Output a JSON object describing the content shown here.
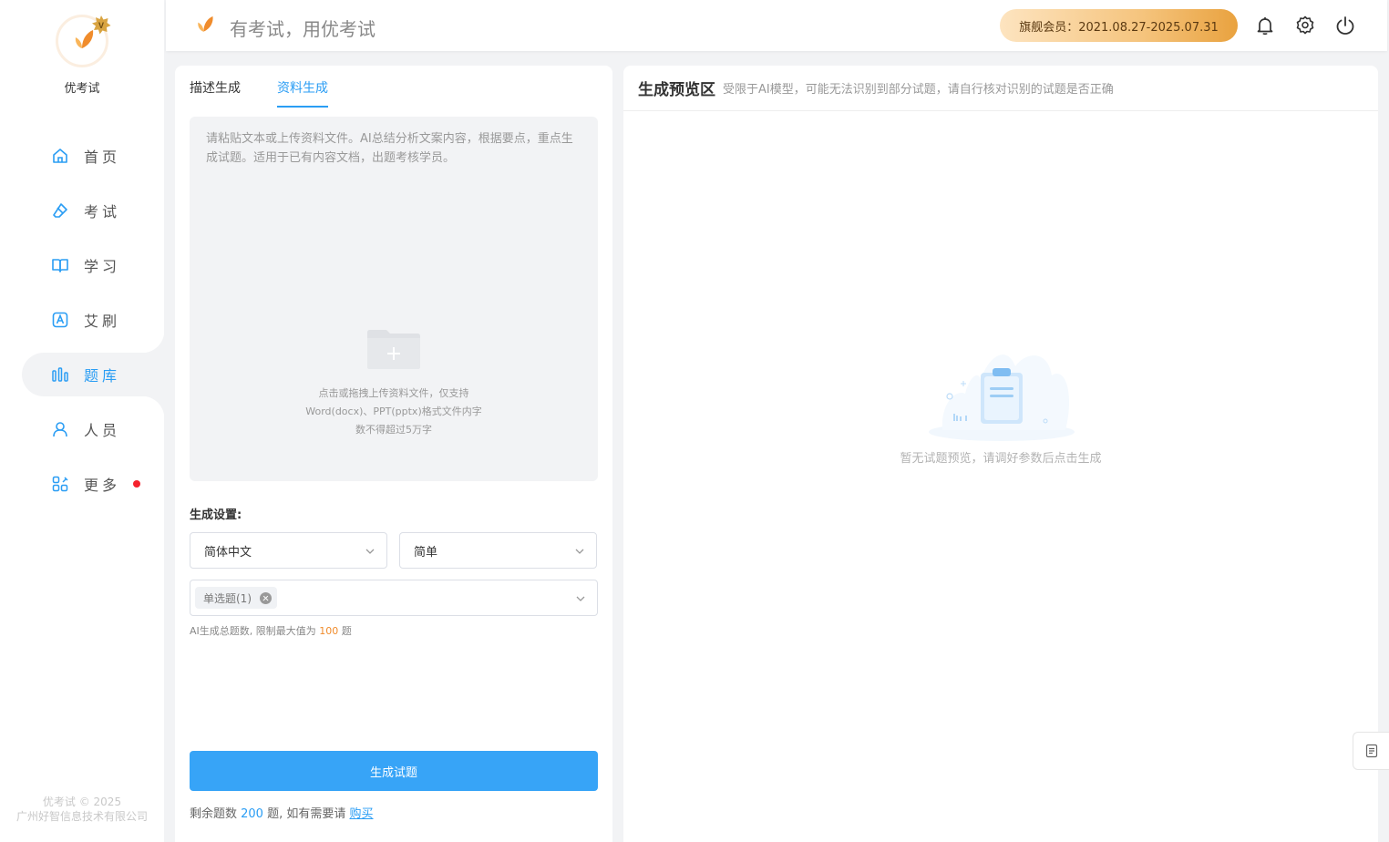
{
  "brand": {
    "name": "优考试",
    "footer_line1": "优考试 © 2025",
    "footer_line2": "广州好智信息技术有限公司"
  },
  "nav": {
    "items": [
      {
        "label": "首页",
        "icon": "home-icon"
      },
      {
        "label": "考试",
        "icon": "eraser-icon"
      },
      {
        "label": "学习",
        "icon": "book-icon"
      },
      {
        "label": "艾刷",
        "icon": "letter-a-icon"
      },
      {
        "label": "题库",
        "icon": "bar-chart-icon",
        "active": true
      },
      {
        "label": "人员",
        "icon": "user-icon"
      },
      {
        "label": "更多",
        "icon": "apps-icon",
        "has_dot": true
      }
    ]
  },
  "header": {
    "slogan": "有考试，用优考试",
    "vip_text": "旗舰会员：2021.08.27-2025.07.31"
  },
  "left_panel": {
    "tabs": [
      "描述生成",
      "资料生成"
    ],
    "active_tab": 1,
    "textarea_placeholder": "请粘贴文本或上传资料文件。AI总结分析文案内容，根据要点，重点生成试题。适用于已有内容文档，出题考核学员。",
    "upload_hint_1": "点击或拖拽上传资料文件，仅支持",
    "upload_hint_2": "Word(docx)、PPT(pptx)格式文件内字",
    "upload_hint_3": "数不得超过5万字",
    "settings_title": "生成设置:",
    "language": "简体中文",
    "difficulty": "简单",
    "question_type_tag": "单选题(1)",
    "limit_prefix": "AI生成总题数, 限制最大值为 ",
    "limit_value": "100",
    "limit_suffix": " 题",
    "generate_button": "生成试题",
    "remaining_prefix": "剩余题数 ",
    "remaining_value": "200",
    "remaining_middle": " 题, 如有需要请 ",
    "buy_link": "购买"
  },
  "right_panel": {
    "title": "生成预览区",
    "subtitle": "受限于AI模型，可能无法识别到部分试题，请自行核对识别的试题是否正确",
    "empty_text": "暂无试题预览，请调好参数后点击生成"
  },
  "colors": {
    "accent": "#2a9df4",
    "button": "#37a4f7",
    "vip_gold": "#e9a23f",
    "dot": "#f5222d"
  }
}
